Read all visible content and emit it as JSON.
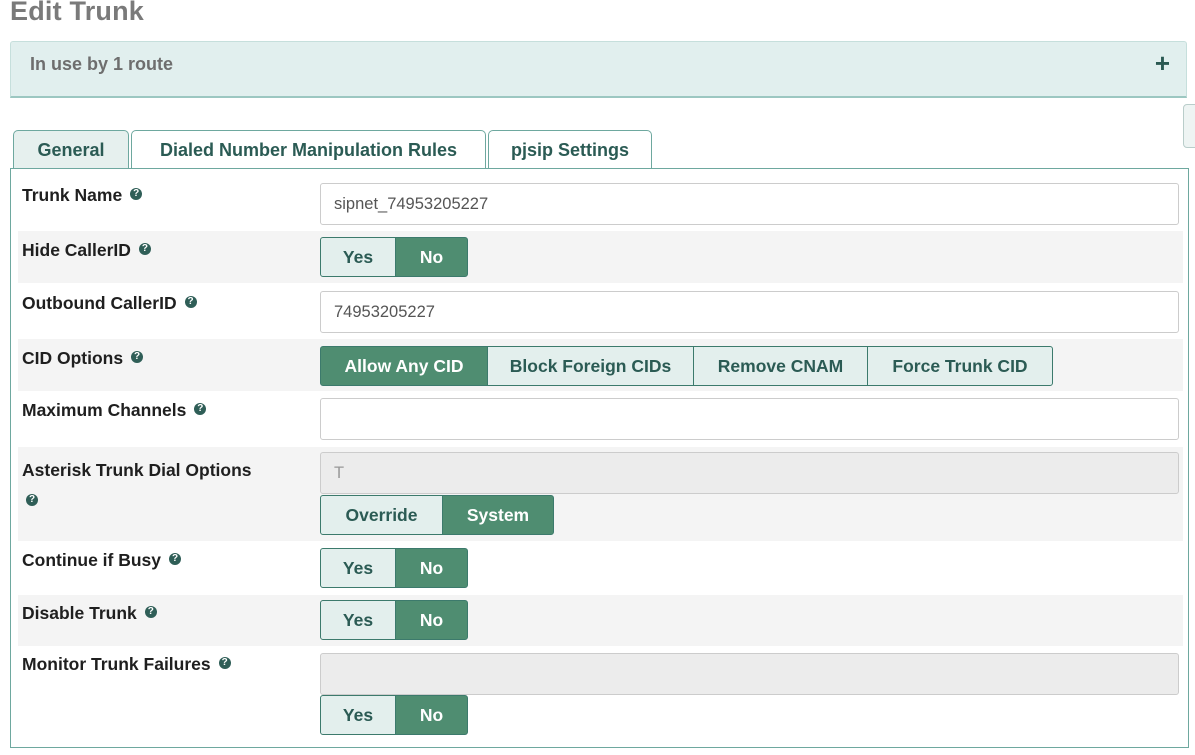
{
  "page": {
    "title": "Edit Trunk"
  },
  "usage": {
    "text": "In use by 1 route",
    "expand_icon": "+"
  },
  "tabs": [
    {
      "label": "General",
      "active": true
    },
    {
      "label": "Dialed Number Manipulation Rules",
      "active": false
    },
    {
      "label": "pjsip Settings",
      "active": false
    }
  ],
  "help_icon_glyph": "?",
  "fields": {
    "trunk_name": {
      "label": "Trunk Name",
      "value": "sipnet_74953205227"
    },
    "hide_callerid": {
      "label": "Hide CallerID",
      "options": [
        "Yes",
        "No"
      ],
      "selected": "No"
    },
    "outbound_callerid": {
      "label": "Outbound CallerID",
      "value": "74953205227"
    },
    "cid_options": {
      "label": "CID Options",
      "options": [
        "Allow Any CID",
        "Block Foreign CIDs",
        "Remove CNAM",
        "Force Trunk CID"
      ],
      "selected": "Allow Any CID"
    },
    "max_channels": {
      "label": "Maximum Channels",
      "value": ""
    },
    "dial_options": {
      "label": "Asterisk Trunk Dial Options",
      "value": "T",
      "options": [
        "Override",
        "System"
      ],
      "selected": "System"
    },
    "continue_if_busy": {
      "label": "Continue if Busy",
      "options": [
        "Yes",
        "No"
      ],
      "selected": "No"
    },
    "disable_trunk": {
      "label": "Disable Trunk",
      "options": [
        "Yes",
        "No"
      ],
      "selected": "No"
    },
    "monitor_failures": {
      "label": "Monitor Trunk Failures",
      "value": "",
      "options": [
        "Yes",
        "No"
      ],
      "selected": "No"
    }
  },
  "colors": {
    "accent": "#4f8d71",
    "panel_bg": "#e1efee",
    "tab_text": "#2b5b54"
  }
}
